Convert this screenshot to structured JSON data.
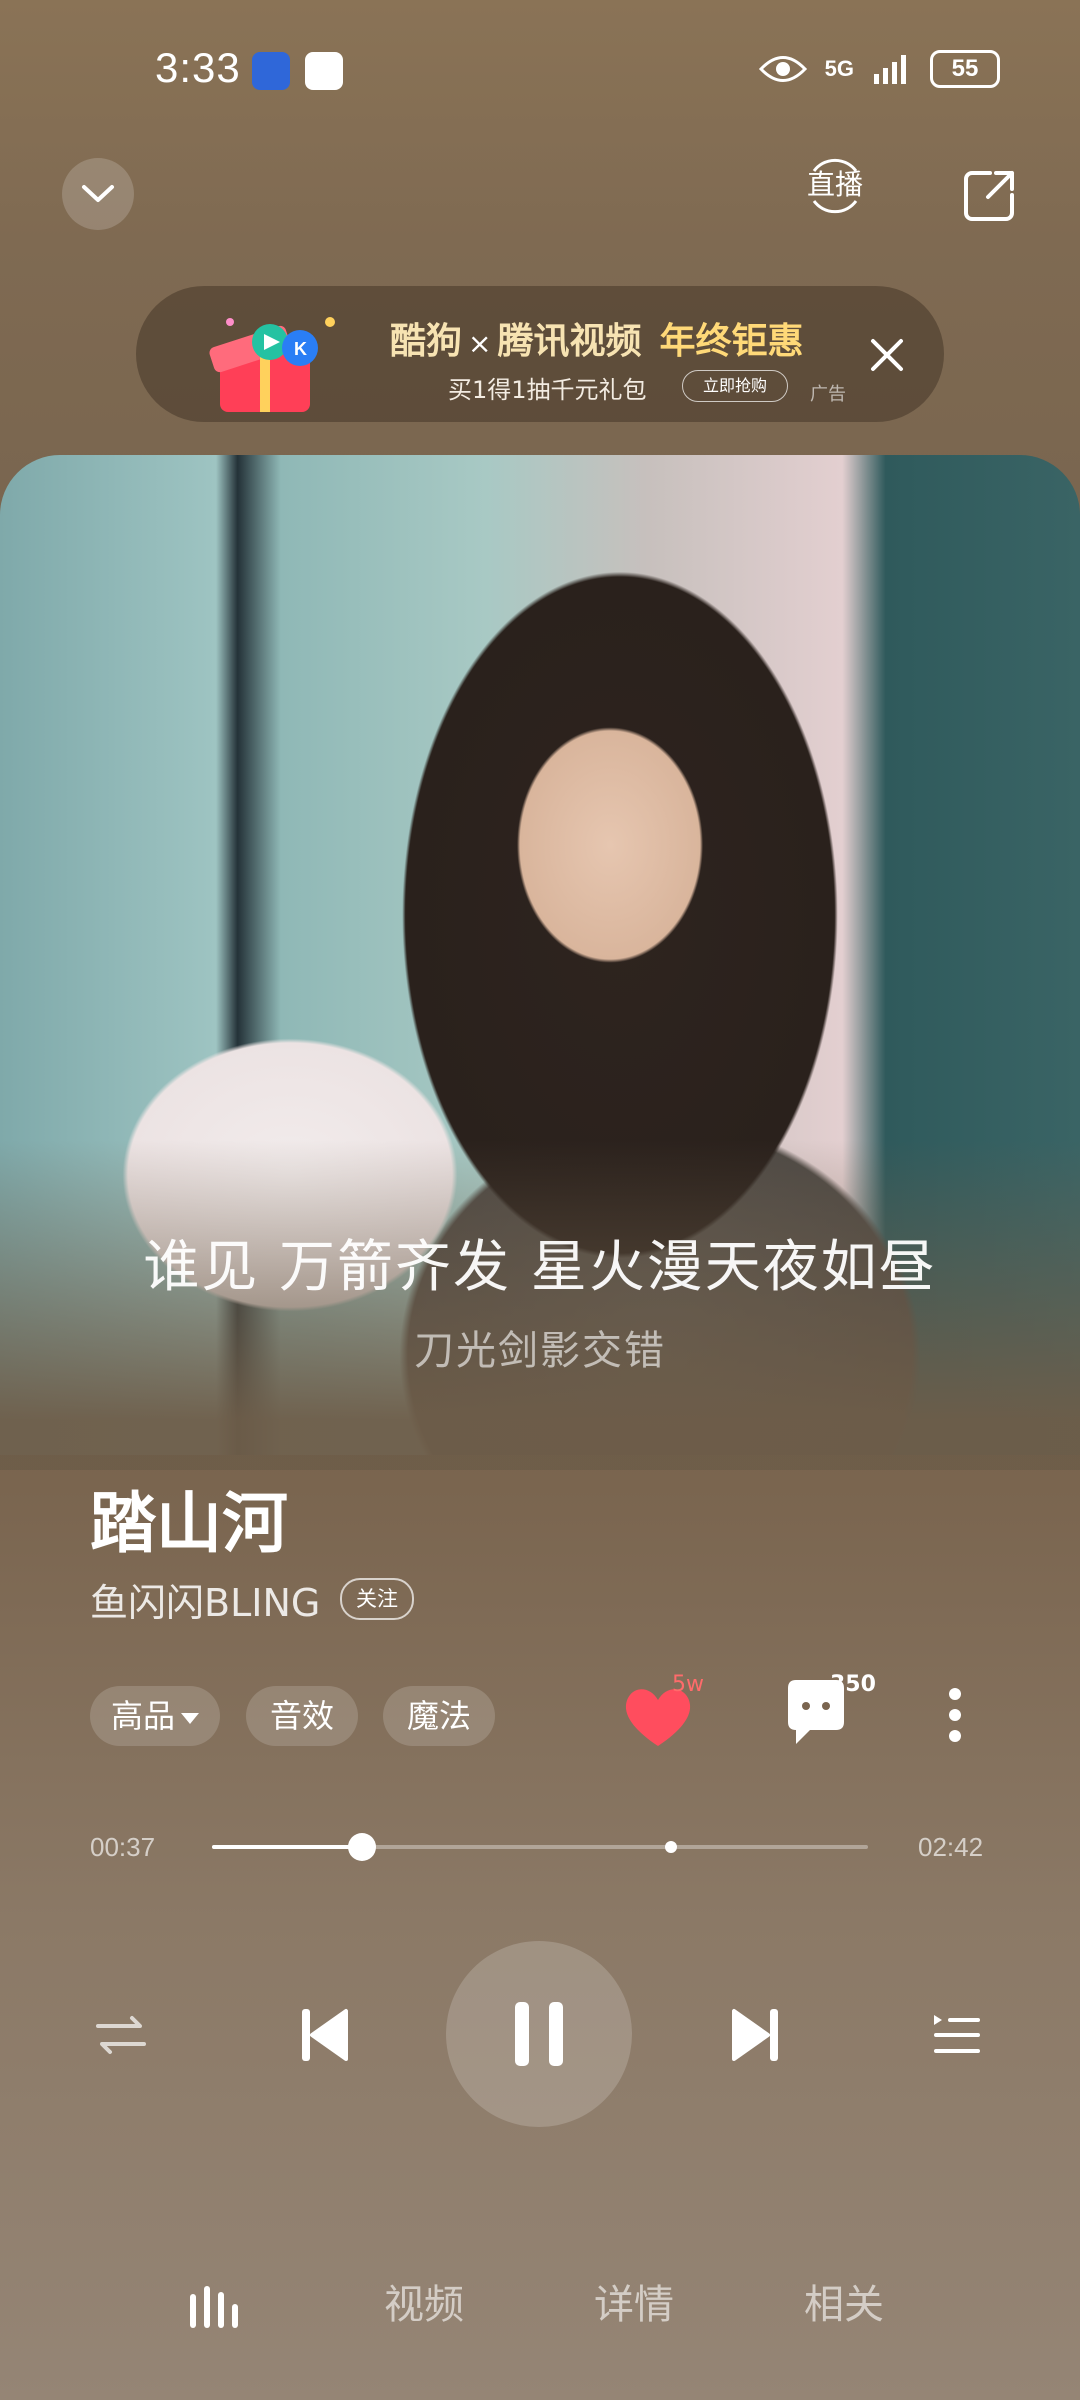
{
  "status_bar": {
    "time": "3:33",
    "network": "5G",
    "battery": "55"
  },
  "top_bar": {
    "live_label": "直播"
  },
  "ad": {
    "brand_left": "酷狗",
    "cross": "×",
    "brand_right": "腾讯视频",
    "headline_suffix": "年终钜惠",
    "subtitle": "买1得1抽千元礼包",
    "cta": "立即抢购",
    "tag": "广告"
  },
  "lyrics": {
    "current": "谁见 万箭齐发 星火漫天夜如昼",
    "next": "刀光剑影交错"
  },
  "song": {
    "title": "踏山河",
    "artist": "鱼闪闪BLING",
    "follow_label": "关注"
  },
  "chips": {
    "quality": "高品",
    "effect": "音效",
    "magic": "魔法"
  },
  "actions": {
    "like_count": "5w",
    "comment_count": "350"
  },
  "progress": {
    "current_time": "00:37",
    "total_time": "02:42",
    "played_fraction": 0.228,
    "marker_fraction": 0.7
  },
  "tabs": {
    "video": "视频",
    "details": "详情",
    "related": "相关"
  },
  "colors": {
    "like": "#ff4d5e",
    "accent_gold": "#f7e3b2"
  }
}
